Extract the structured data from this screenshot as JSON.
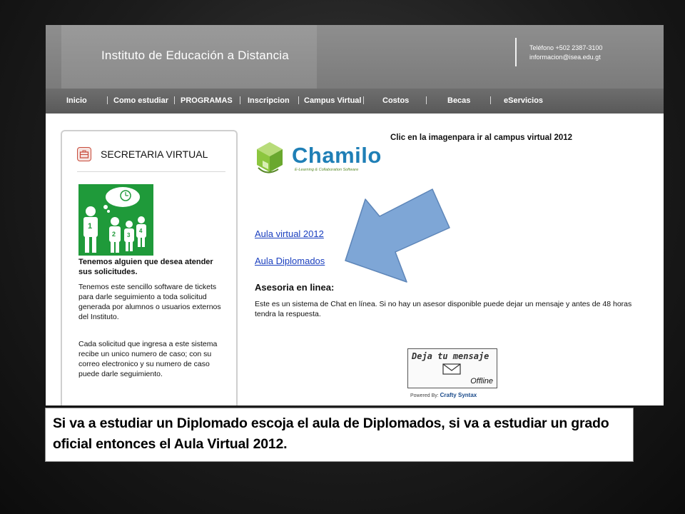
{
  "header": {
    "site_title": "Instituto de Educación a Distancia",
    "phone": "Teléfono +502 2387-3100",
    "email": "informacion@isea.edu.gt"
  },
  "nav": {
    "items": [
      "Inicio",
      "Como estudiar",
      "PROGRAMAS",
      "Inscripcion",
      "Campus Virtual",
      "Costos",
      "Becas",
      "eServicios"
    ]
  },
  "sidebar": {
    "title": "SECRETARIA VIRTUAL",
    "heading": "Tenemos alguien que desea atender sus solicitudes.",
    "paragraph1": "Tenemos este sencillo software de tickets para darle seguimiento a toda solicitud generada por alumnos o usuarios externos del Instituto.",
    "paragraph2": "Cada solicitud que ingresa a este sistema recibe un unico numero de caso; con su correo electronico y su numero de caso puede darle seguimiento."
  },
  "main": {
    "campus_caption": "Clic en la imagenpara ir al campus virtual 2012",
    "logo_word": "Chamilo",
    "logo_tagline": "E-Learning & Collaboration Software",
    "link_aula_2012": "Aula virtual 2012",
    "link_aula_diplomados": "Aula Diplomados",
    "asesoria_title": "Asesoria en linea:",
    "asesoria_text": "Este es un sistema de Chat en línea.  Si no hay un asesor disponible puede dejar un mensaje y antes de 48 horas tendra la respuesta.",
    "chat_label": "Deja tu mensaje",
    "chat_status": "Offline",
    "powered_label": "Powered By:",
    "powered_brand": "Crafty Syntax"
  },
  "caption": {
    "text": "Si va a estudiar un Diplomado escoja el aula de Diplomados, si va a estudiar un grado oficial entonces el Aula Virtual 2012."
  },
  "colors": {
    "link": "#1a3fbf",
    "header": "#8a8a8a",
    "nav": "#626262",
    "arrow": "#7ea6d6",
    "chamilo_blue": "#1f7fb6",
    "chamilo_green": "#8cc63f"
  }
}
